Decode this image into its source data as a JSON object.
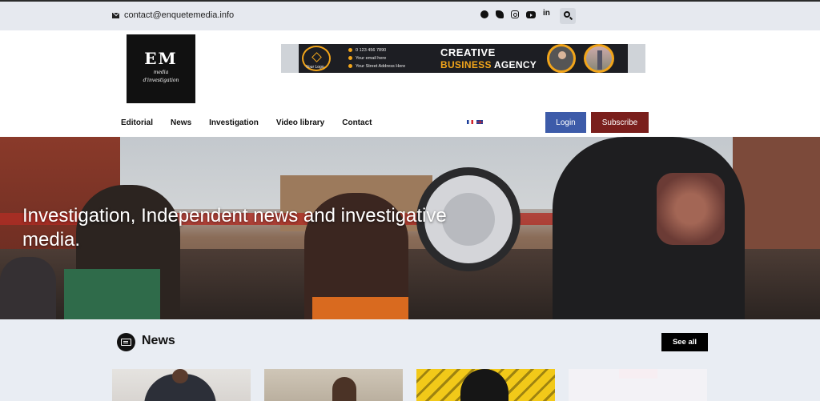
{
  "topbar": {
    "email": "contact@enquetemedia.info",
    "social_icons": [
      "facebook-icon",
      "twitter-icon",
      "instagram-icon",
      "youtube-icon",
      "linkedin-icon"
    ],
    "search_icon": "search-icon"
  },
  "logo": {
    "mark": "EM",
    "subtitle_line1": "media",
    "subtitle_line2": "d'investigation"
  },
  "ad_banner": {
    "logo_text": "Your Logo",
    "phone": "0 123 456 7890",
    "email_line": "Your email here",
    "address_line": "Your Street Address Here",
    "title_line1": "CREATIVE",
    "title_line2_accent": "BUSINESS",
    "title_line2_rest": "AGENCY"
  },
  "nav": {
    "items": [
      "Editorial",
      "News",
      "Investigation",
      "Video library",
      "Contact"
    ],
    "languages": [
      "fr",
      "en"
    ],
    "login_label": "Login",
    "subscribe_label": "Subscribe"
  },
  "hero": {
    "title": "Investigation, Independent news and investigative media."
  },
  "news": {
    "section_title": "News",
    "see_all_label": "See all",
    "cards_visible": 4
  },
  "colors": {
    "login_bg": "#3d5ba9",
    "subscribe_bg": "#7a1f1c",
    "page_bg": "#e9edf3",
    "accent_orange": "#f2a51a"
  }
}
